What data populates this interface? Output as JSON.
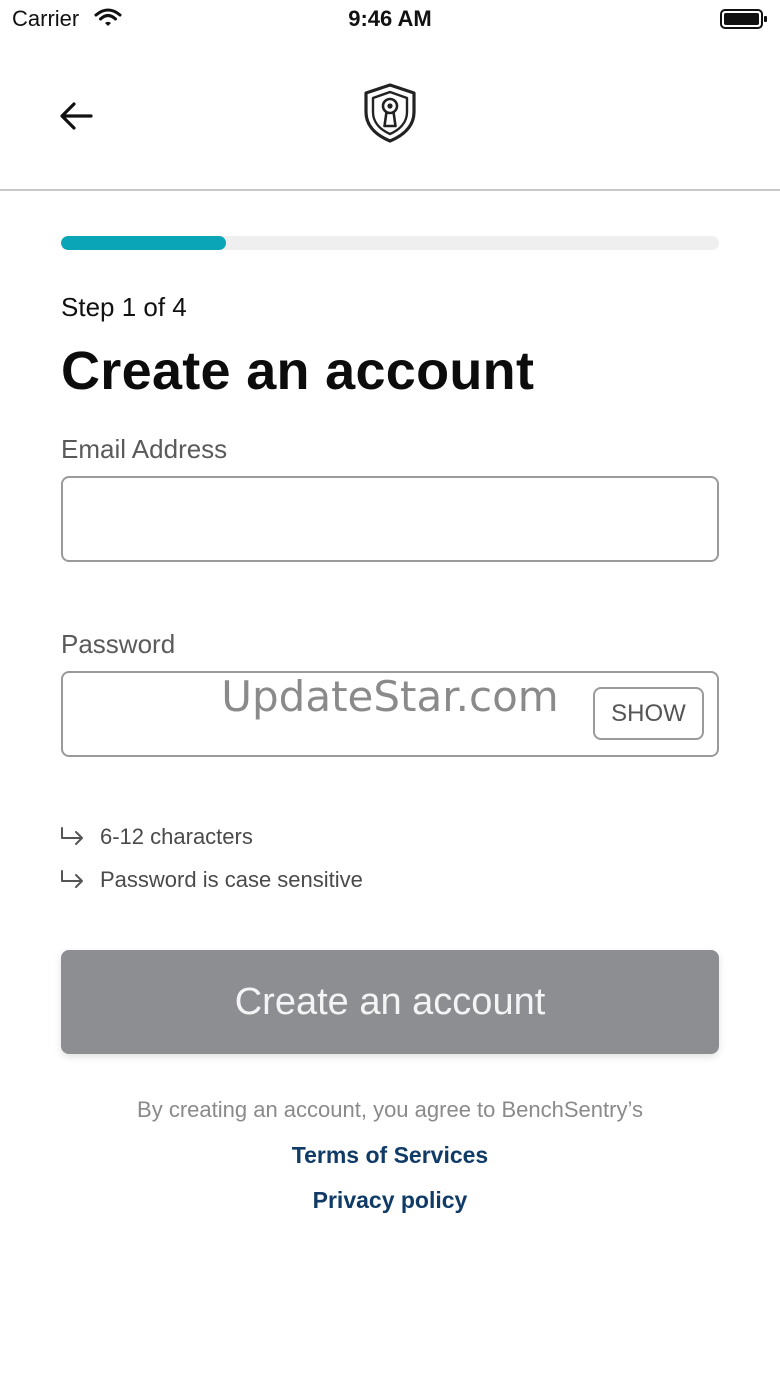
{
  "status_bar": {
    "carrier": "Carrier",
    "time": "9:46 AM"
  },
  "nav": {
    "back_icon": "arrow-left-icon",
    "logo_icon": "shield-keyhole-icon"
  },
  "progress": {
    "current_step": 1,
    "total_steps": 4,
    "fraction": 0.25
  },
  "colors": {
    "accent": "#0aa6b8",
    "button_disabled": "#8c8e92",
    "link": "#0f3b66"
  },
  "step_label": "Step 1 of 4",
  "title": "Create an account",
  "form": {
    "email_label": "Email Address",
    "email_value": "",
    "password_label": "Password",
    "password_value": "",
    "show_label": "SHOW"
  },
  "watermark": "UpdateStar.com",
  "hints": [
    "6-12 characters",
    "Password is case sensitive"
  ],
  "submit_label": "Create an account",
  "agreement_text": "By creating an account, you agree to BenchSentry’s",
  "terms_label": "Terms of Services",
  "privacy_label": "Privacy policy"
}
